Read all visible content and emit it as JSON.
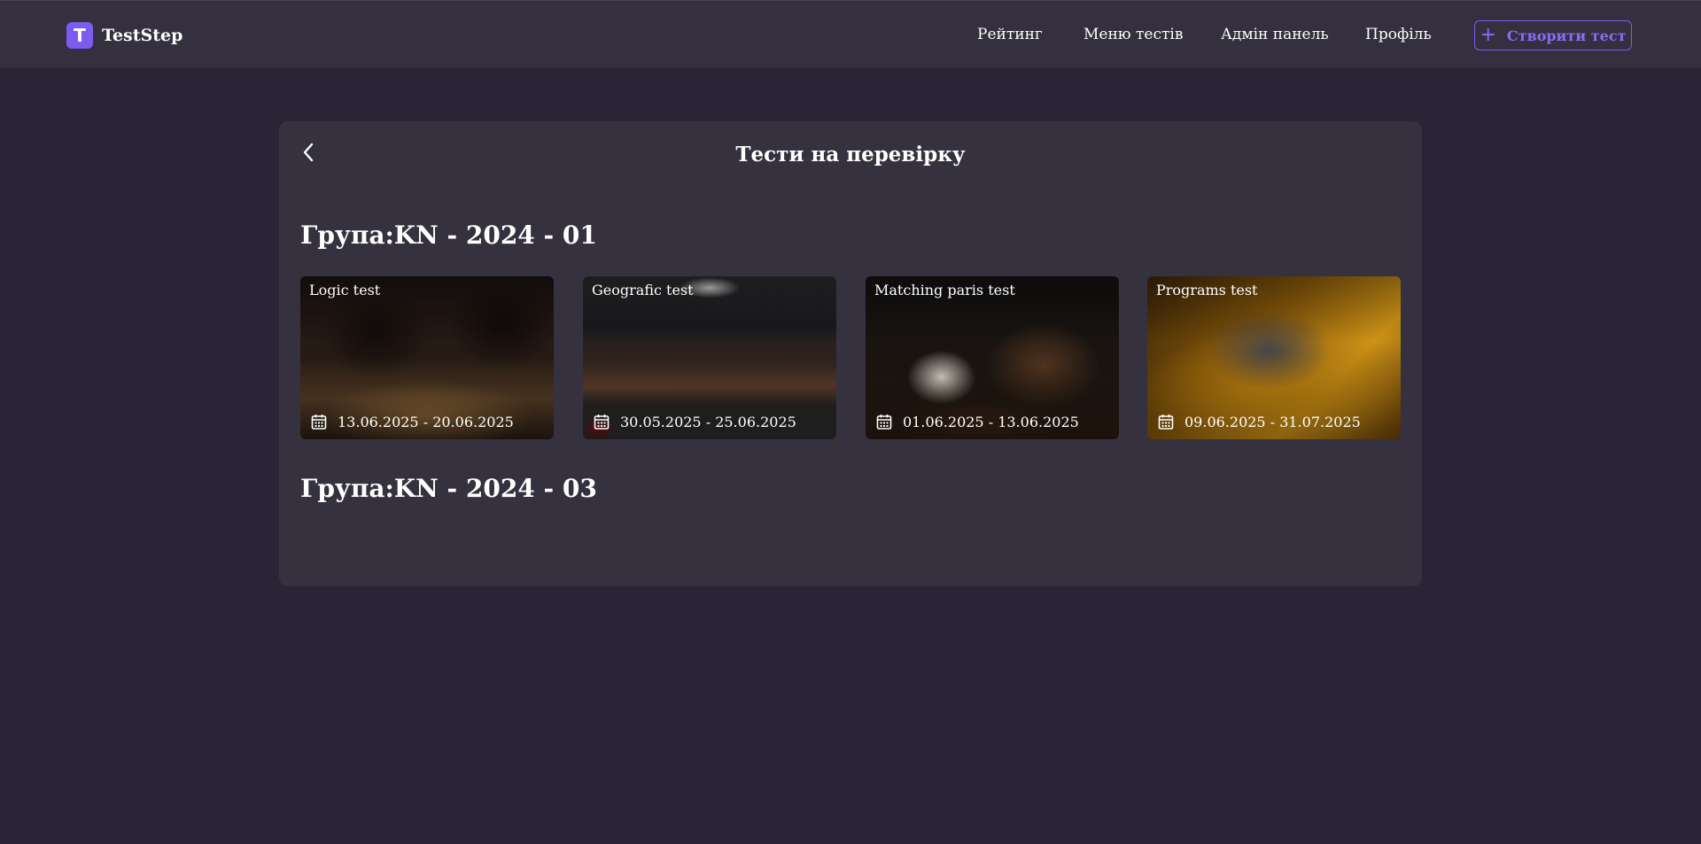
{
  "header": {
    "logo_letter": "T",
    "app_name": "TestStep",
    "nav": [
      {
        "label": "Рейтинг"
      },
      {
        "label": "Меню тестів"
      },
      {
        "label": "Адмін панель"
      },
      {
        "label": "Профіль"
      }
    ],
    "create_button": {
      "icon": "plus-icon",
      "label": "Створити тест"
    }
  },
  "colors": {
    "accent": "#7c5cf0",
    "page_bg": "#292536",
    "panel_bg": "#35313f",
    "header_bg": "#34303f"
  },
  "panel": {
    "back_icon": "chevron-left-icon",
    "title": "Тести на перевірку",
    "groups": [
      {
        "title": "Група:KN - 2024 - 01",
        "tests": [
          {
            "title": "Logic test",
            "dates": "13.06.2025 - 20.06.2025",
            "icon": "calendar-icon"
          },
          {
            "title": "Geografic test",
            "dates": "30.05.2025 - 25.06.2025",
            "icon": "calendar-icon"
          },
          {
            "title": "Matching paris test",
            "dates": "01.06.2025 - 13.06.2025",
            "icon": "calendar-icon"
          },
          {
            "title": "Programs test",
            "dates": "09.06.2025 - 31.07.2025",
            "icon": "calendar-icon"
          }
        ]
      },
      {
        "title": "Група:KN - 2024 - 03",
        "tests": []
      }
    ]
  }
}
